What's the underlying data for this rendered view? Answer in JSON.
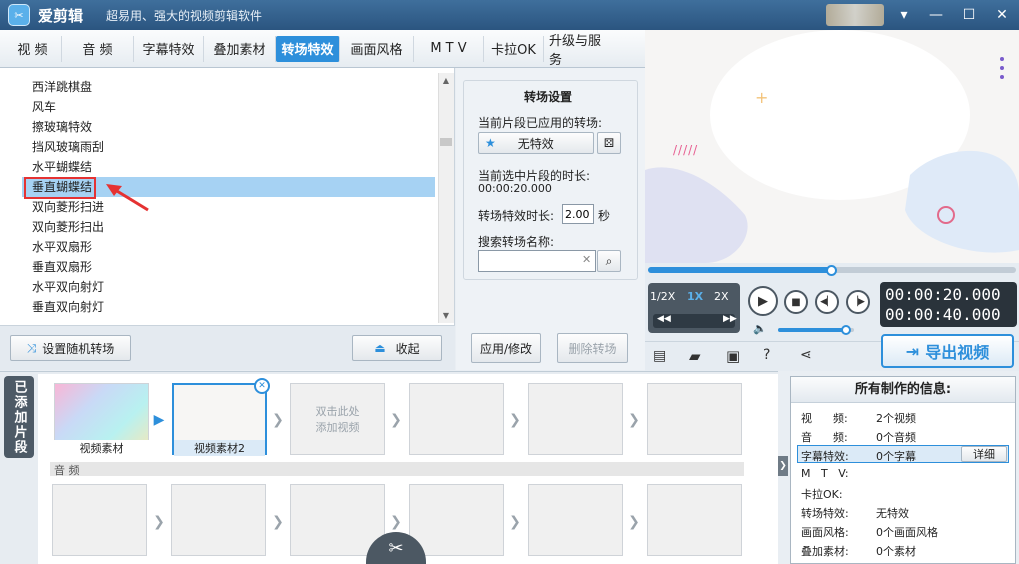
{
  "titlebar": {
    "app_name": "爱剪辑",
    "slogan": "超易用、强大的视频剪辑软件",
    "logo_glyph": "✂",
    "minimize": "—",
    "maximize": "☐",
    "close": "✕",
    "menu": "▾"
  },
  "tabs": [
    {
      "label": "视 频",
      "active": false
    },
    {
      "label": "音 频",
      "active": false
    },
    {
      "label": "字幕特效",
      "active": false
    },
    {
      "label": "叠加素材",
      "active": false
    },
    {
      "label": "转场特效",
      "active": true
    },
    {
      "label": "画面风格",
      "active": false
    },
    {
      "label": "M T V",
      "active": false
    },
    {
      "label": "卡拉OK",
      "active": false
    },
    {
      "label": "升级与服务",
      "active": false
    }
  ],
  "transitions": {
    "items": [
      "西洋跳棋盘",
      "风车",
      "擦玻璃特效",
      "挡风玻璃雨刮",
      "水平蝴蝶结",
      "垂直蝴蝶结",
      "双向菱形扫进",
      "双向菱形扫出",
      "水平双扇形",
      "垂直双扇形",
      "水平双向射灯",
      "垂直双向射灯"
    ],
    "selected_index": 5
  },
  "list_buttons": {
    "random": "设置随机转场",
    "collapse": "收起"
  },
  "settings": {
    "title": "转场设置",
    "applied_label": "当前片段已应用的转场:",
    "applied_value": "无特效",
    "duration_label": "当前选中片段的时长:",
    "duration_value": "00:00:20.000",
    "effect_duration_label": "转场特效时长:",
    "effect_duration_value": "2.00",
    "effect_duration_unit": "秒",
    "search_label": "搜索转场名称:",
    "search_value": "",
    "apply_button": "应用/修改",
    "delete_button": "删除转场"
  },
  "player": {
    "speeds": [
      "1/2X",
      "1X",
      "2X"
    ],
    "active_speed": "1X",
    "current_time": "00:00:20.000",
    "total_time": "00:00:40.000",
    "progress": 0.5,
    "volume": 0.9,
    "export_button": "导出视频"
  },
  "timeline": {
    "vertical_tab": "已添加片段",
    "clips": [
      {
        "label": "视频素材",
        "selected": false
      },
      {
        "label": "视频素材2",
        "selected": true
      }
    ],
    "add_hint": "双击此处\n添加视频",
    "audio_label": "音 频"
  },
  "info": {
    "title": "所有制作的信息:",
    "rows": [
      {
        "key": "视      频:",
        "value": "2个视频"
      },
      {
        "key": "音      频:",
        "value": "0个音频"
      },
      {
        "key": "字幕特效:",
        "value": "0个字幕"
      },
      {
        "key": "M   T   V:",
        "value": ""
      },
      {
        "key": "卡拉OK:",
        "value": ""
      },
      {
        "key": "转场特效:",
        "value": "无特效"
      },
      {
        "key": "画面风格:",
        "value": "0个画面风格"
      },
      {
        "key": "叠加素材:",
        "value": "0个素材"
      }
    ],
    "detail_button": "详细"
  },
  "colors": {
    "accent": "#2d8fdb",
    "selected_row": "#a6d2f3",
    "highlight_box": "#e53232"
  }
}
